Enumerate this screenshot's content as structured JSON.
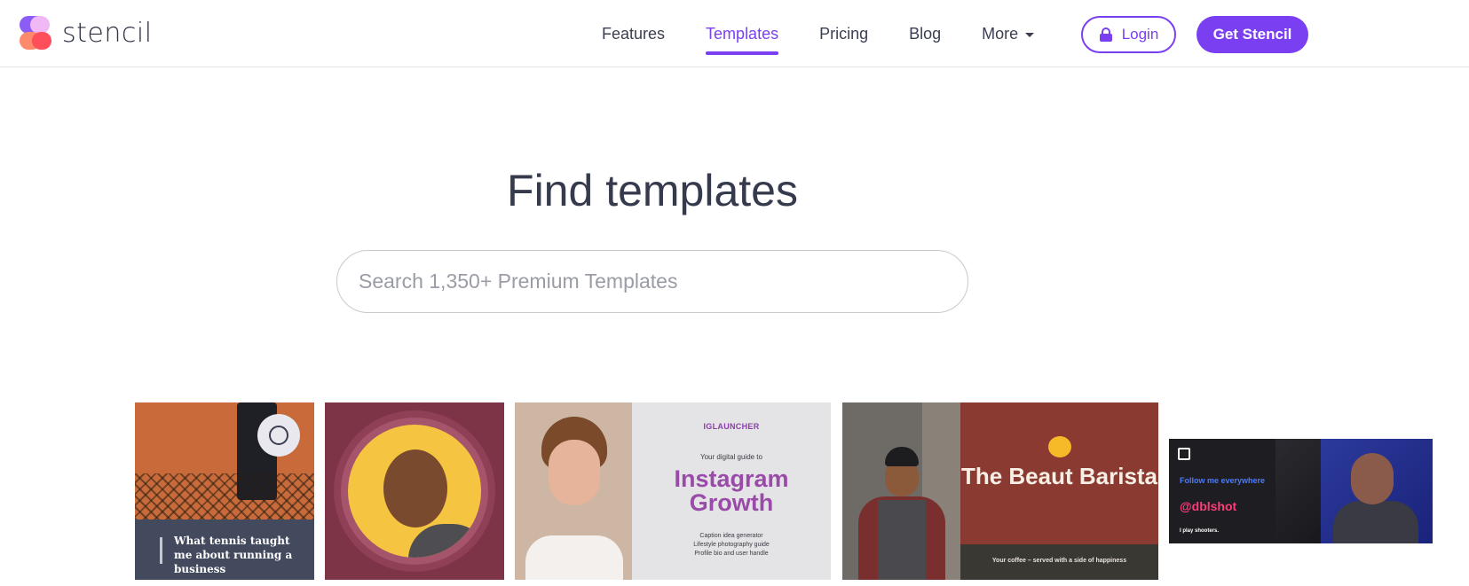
{
  "brand": {
    "name": "stencil"
  },
  "nav": {
    "features": "Features",
    "templates": "Templates",
    "pricing": "Pricing",
    "blog": "Blog",
    "more": "More",
    "login": "Login",
    "get_stencil": "Get Stencil",
    "active": "Templates"
  },
  "hero": {
    "title": "Find templates",
    "search_placeholder": "Search 1,350+ Premium Templates"
  },
  "templates": {
    "tennis": {
      "caption": "What tennis taught me about running a business"
    },
    "instagram": {
      "brand": "IGLAUNCHER",
      "subtitle": "Your digital guide to",
      "title": "Instagram Growth",
      "items": [
        "Caption idea generator",
        "Lifestyle photography guide",
        "Profile bio and user handle"
      ]
    },
    "barista": {
      "title": "The Beaut Barista",
      "footer": "Your coffee – served with a side of happiness"
    },
    "gamer": {
      "follow": "Follow me everywhere",
      "handle": "@dblshot",
      "tagline": "I play shooters."
    }
  },
  "colors": {
    "accent": "#7b3ff2",
    "text": "#3b3f51"
  }
}
